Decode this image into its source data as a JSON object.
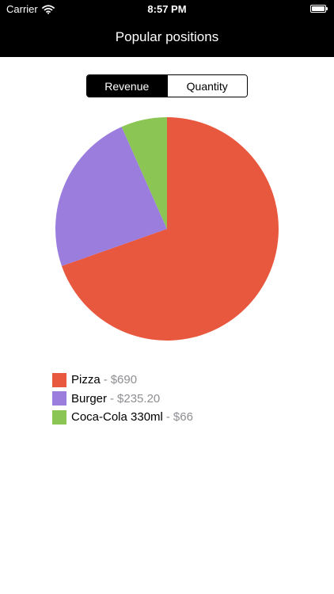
{
  "status_bar": {
    "carrier": "Carrier",
    "time": "8:57 PM"
  },
  "nav": {
    "title": "Popular positions"
  },
  "segmented_control": {
    "options": [
      "Revenue",
      "Quantity"
    ],
    "selected": "Revenue"
  },
  "colors": {
    "pizza": "#e8583e",
    "burger": "#9b7dde",
    "coca_cola": "#8bc554"
  },
  "legend": {
    "separator": "-",
    "items": [
      {
        "label": "Pizza",
        "value": "$690"
      },
      {
        "label": "Burger",
        "value": "$235.20"
      },
      {
        "label": "Coca-Cola 330ml",
        "value": "$66"
      }
    ]
  },
  "chart_data": {
    "type": "pie",
    "categories": [
      "Pizza",
      "Burger",
      "Coca-Cola 330ml"
    ],
    "values": [
      690,
      235.2,
      66
    ],
    "colors": [
      "#e8583e",
      "#9b7dde",
      "#8bc554"
    ],
    "start_angle": "top",
    "direction": "clockwise"
  }
}
